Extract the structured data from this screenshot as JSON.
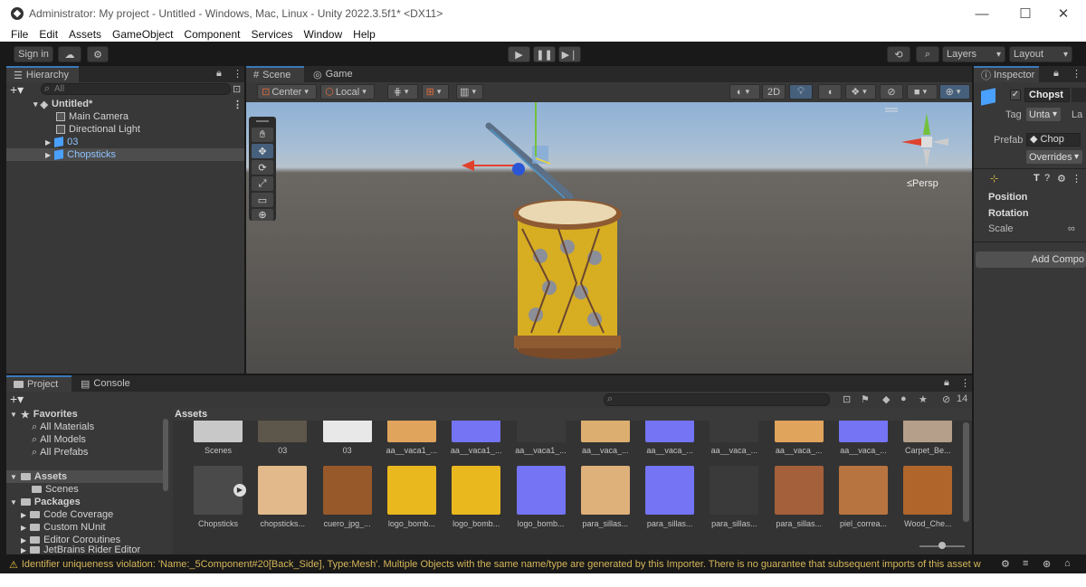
{
  "window": {
    "title": "Administrator: My project - Untitled - Windows, Mac, Linux - Unity 2022.3.5f1* <DX11>",
    "minimize": "—",
    "maximize": "☐",
    "close": "✕"
  },
  "menu": [
    "File",
    "Edit",
    "Assets",
    "GameObject",
    "Component",
    "Services",
    "Window",
    "Help"
  ],
  "toolbar": {
    "sign_in": "Sign in",
    "layers": "Layers",
    "layout": "Layout"
  },
  "hierarchy": {
    "tab": "Hierarchy",
    "search_placeholder": "All",
    "items": [
      {
        "label": "Untitled*"
      },
      {
        "label": "Main Camera"
      },
      {
        "label": "Directional Light"
      },
      {
        "label": "03"
      },
      {
        "label": "Chopsticks"
      }
    ]
  },
  "scene": {
    "tab_scene": "Scene",
    "tab_game": "Game",
    "pivot": "Center",
    "space": "Local",
    "mode_2d": "2D",
    "persp": "≤Persp"
  },
  "inspector": {
    "tab": "Inspector",
    "object_name": "Chopst",
    "tag_label": "Tag",
    "tag_value": "Unta",
    "layer_label": "La",
    "prefab_label": "Prefab",
    "prefab_value": "Chop",
    "overrides": "Overrides",
    "transform_letter": "T",
    "position": "Position",
    "rotation": "Rotation",
    "scale": "Scale",
    "add_component": "Add Compo"
  },
  "project": {
    "tab_project": "Project",
    "tab_console": "Console",
    "hidden_count": "14",
    "breadcrumb": "Assets",
    "tree": [
      {
        "label": "Favorites"
      },
      {
        "label": "All Materials"
      },
      {
        "label": "All Models"
      },
      {
        "label": "All Prefabs"
      },
      {
        "label": "Assets"
      },
      {
        "label": "Scenes"
      },
      {
        "label": "Packages"
      },
      {
        "label": "Code Coverage"
      },
      {
        "label": "Custom NUnit"
      },
      {
        "label": "Editor Coroutines"
      },
      {
        "label": "JetBrains Rider Editor"
      }
    ],
    "row1": [
      {
        "label": "Scenes",
        "color": "#c8c8c8"
      },
      {
        "label": "03",
        "color": "#5d564a"
      },
      {
        "label": "03",
        "color": "#e8e8e8"
      },
      {
        "label": "aa__vaca1_...",
        "color": "#e0a45c"
      },
      {
        "label": "aa__vaca1_...",
        "color": "#7474f4"
      },
      {
        "label": "aa__vaca1_...",
        "color": "#3a3a3a"
      },
      {
        "label": "aa__vaca_...",
        "color": "#dcae70"
      },
      {
        "label": "aa__vaca_...",
        "color": "#7474f4"
      },
      {
        "label": "aa__vaca_...",
        "color": "#3a3a3a"
      },
      {
        "label": "aa__vaca_...",
        "color": "#e0a45c"
      },
      {
        "label": "aa__vaca_...",
        "color": "#7474f4"
      },
      {
        "label": "Carpet_Be...",
        "color": "#b59f8a"
      }
    ],
    "row2": [
      {
        "label": "Chopsticks",
        "color": "#4a4a4a"
      },
      {
        "label": "chopsticks...",
        "color": "#e2b98a"
      },
      {
        "label": "cuero_jpg_...",
        "color": "#97592a"
      },
      {
        "label": "logo_bomb...",
        "color": "#e8b81e"
      },
      {
        "label": "logo_bomb...",
        "color": "#e8b81e"
      },
      {
        "label": "logo_bomb...",
        "color": "#7474f4"
      },
      {
        "label": "para_sillas...",
        "color": "#deb07a"
      },
      {
        "label": "para_sillas...",
        "color": "#7474f4"
      },
      {
        "label": "para_sillas...",
        "color": "#3a3a3a"
      },
      {
        "label": "para_sillas...",
        "color": "#a4603a"
      },
      {
        "label": "piel_correa...",
        "color": "#b87440"
      },
      {
        "label": "Wood_Che...",
        "color": "#b0662a"
      }
    ]
  },
  "status": {
    "message": "Identifier uniqueness violation: 'Name:_5Component#20[Back_Side], Type:Mesh'. Multiple Objects with the same name/type are generated by this Importer. There is no guarantee that subsequent imports of this asset w"
  }
}
